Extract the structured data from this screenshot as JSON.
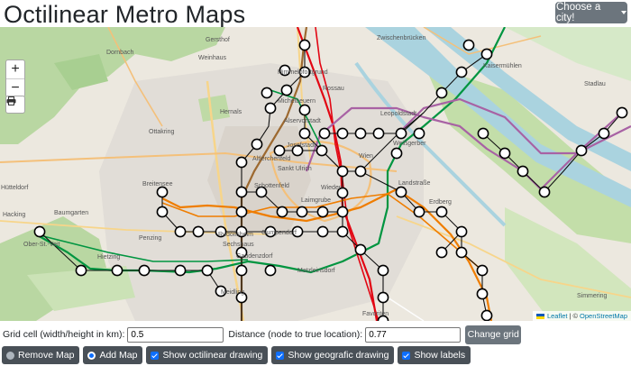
{
  "header": {
    "title": "Octilinear Metro Maps",
    "city_button": "Choose a city!"
  },
  "map": {
    "zoom_in": "+",
    "zoom_out": "−",
    "attribution_leaflet": "Leaflet",
    "attribution_sep": "| ©",
    "attribution_osm": "OpenStreetMap",
    "place_labels": [
      {
        "name": "Dornbach",
        "cls": "tp"
      },
      {
        "name": "Gersthof",
        "cls": "tp"
      },
      {
        "name": "Weinhaus",
        "cls": "tp"
      },
      {
        "name": "Himmelpfortgrund",
        "cls": "tp"
      },
      {
        "name": "Zwischenbrücken",
        "cls": "tp"
      },
      {
        "name": "Kaisermühlen",
        "cls": "tp"
      },
      {
        "name": "Stadlau",
        "cls": "tp"
      },
      {
        "name": "Rossau",
        "cls": "tp"
      },
      {
        "name": "Michelbeuern",
        "cls": "tp"
      },
      {
        "name": "Alservorstadt",
        "cls": "tp"
      },
      {
        "name": "Hernals",
        "cls": "tp"
      },
      {
        "name": "Ottakring",
        "cls": "tp"
      },
      {
        "name": "Josefstadt",
        "cls": "tp"
      },
      {
        "name": "Leopoldstadt",
        "cls": "tp"
      },
      {
        "name": "Weißgerber",
        "cls": "tp"
      },
      {
        "name": "Altlerchenfeld",
        "cls": "tp"
      },
      {
        "name": "Sankt Ulrich",
        "cls": "tp"
      },
      {
        "name": "Schottenfeld",
        "cls": "tp"
      },
      {
        "name": "Breitensee",
        "cls": "tp"
      },
      {
        "name": "Hütteldorf",
        "cls": "tp"
      },
      {
        "name": "Hacking",
        "cls": "tp"
      },
      {
        "name": "Baumgarten",
        "cls": "tp"
      },
      {
        "name": "Ober-St.-Veit",
        "cls": "tp"
      },
      {
        "name": "Penzing",
        "cls": "tp"
      },
      {
        "name": "Hietzing",
        "cls": "tp"
      },
      {
        "name": "Rudolfsheim",
        "cls": "tp"
      },
      {
        "name": "Gaudenzdorf",
        "cls": "tp"
      },
      {
        "name": "Gumpendorf",
        "cls": "tp"
      },
      {
        "name": "Laimgrube",
        "cls": "tp"
      },
      {
        "name": "Matzleinsdorf",
        "cls": "tp"
      },
      {
        "name": "Meidling",
        "cls": "tp"
      },
      {
        "name": "Favoriten",
        "cls": "tp"
      },
      {
        "name": "Landstraße",
        "cls": "tp"
      },
      {
        "name": "Erdberg",
        "cls": "tp"
      },
      {
        "name": "Wieden",
        "cls": "tp"
      },
      {
        "name": "Simmering",
        "cls": "tp"
      },
      {
        "name": "Sechshaus",
        "cls": "tp"
      },
      {
        "name": "Wien",
        "cls": "tp"
      }
    ]
  },
  "grid_controls": {
    "cell_label": "Grid cell (width/height in km):",
    "cell_value": "0.5",
    "distance_label": "Distance (node to true location):",
    "distance_value": "0.77",
    "change_button": "Change grid"
  },
  "toolbar": {
    "remove_map": "Remove Map",
    "add_map": "Add Map",
    "show_octilinear": "Show octilinear drawing",
    "show_geographic": "Show geografic drawing",
    "show_labels": "Show labels"
  },
  "colors": {
    "line_u1": "#e20613",
    "line_u2": "#a862a4",
    "line_u3": "#ef7d00",
    "line_u4": "#009540",
    "line_u6": "#9d6930",
    "button_dark": "#495057",
    "button_secondary": "#6c757d",
    "checkbox": "#0d6efd"
  }
}
